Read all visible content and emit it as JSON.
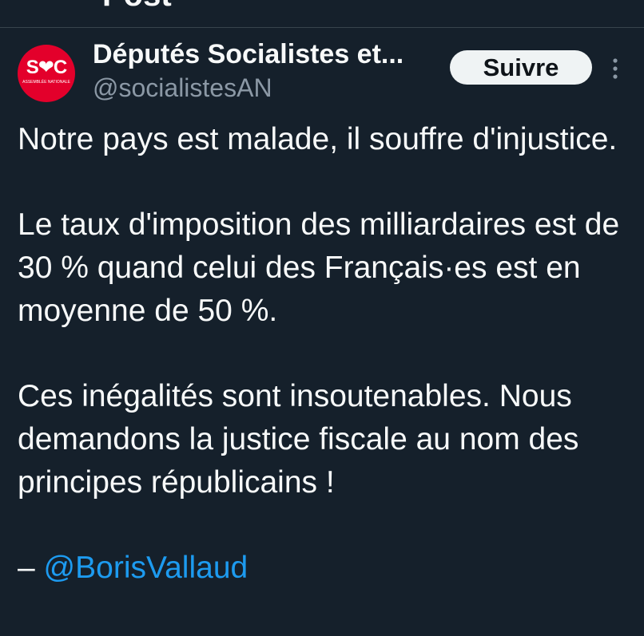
{
  "header": {
    "title": "Post"
  },
  "account": {
    "avatar_text": "S❤C",
    "avatar_subtext": "ASSEMBLÉE NATIONALE",
    "display_name": "Députés Socialistes et...",
    "handle": "@socialistesAN",
    "follow_label": "Suivre",
    "avatar_color": "#e3002b"
  },
  "tweet": {
    "paragraphs": [
      "Notre pays est malade, il souffre d'injustice.",
      "Le taux d'imposition des milliardaires est de 30 % quand celui des Français·es est en moyenne de 50 %.",
      "Ces inégalités sont insoutenables. Nous demandons la justice fiscale au nom des principes républicains !"
    ],
    "signature_dash": "–",
    "signature_mention": "@BorisVallaud"
  },
  "icons": {
    "more": "more-vertical-icon"
  },
  "colors": {
    "background": "#15202b",
    "text": "#f7f9f9",
    "secondary_text": "#8b98a5",
    "link": "#1d9bf0",
    "button_bg": "#eff3f4"
  }
}
